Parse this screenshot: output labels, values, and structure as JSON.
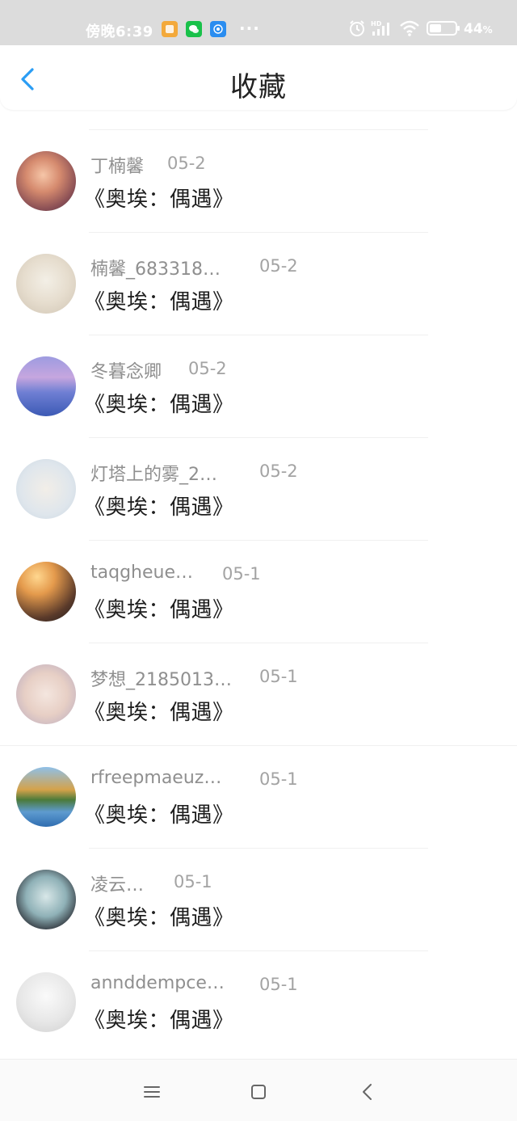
{
  "status_bar": {
    "time": "傍晚6:39",
    "dots": "···",
    "battery_percent": "44",
    "battery_unit": "%",
    "icons": [
      "alarm-icon",
      "hd-signal-icon",
      "wifi-icon",
      "battery-icon"
    ]
  },
  "header": {
    "title": "收藏",
    "back_icon": "chevron-left-icon",
    "accent_color": "#2a9df4"
  },
  "favorites": [
    {
      "username": "丁楠馨",
      "date": "05-2",
      "content": "《奥埃：偶遇》"
    },
    {
      "username": "楠馨_683318…",
      "date": "05-2",
      "content": "《奥埃：偶遇》"
    },
    {
      "username": "冬暮念卿",
      "date": "05-2",
      "content": "《奥埃：偶遇》"
    },
    {
      "username": "灯塔上的雾_2…",
      "date": "05-2",
      "content": "《奥埃：偶遇》"
    },
    {
      "username": "taqgheue…",
      "date": "05-1",
      "content": "《奥埃：偶遇》"
    },
    {
      "username": "梦想_2185013…",
      "date": "05-1",
      "content": "《奥埃：偶遇》"
    },
    {
      "username": "rfreepmaeuz…",
      "date": "05-1",
      "content": "《奥埃：偶遇》"
    },
    {
      "username": "凌云…",
      "date": "05-1",
      "content": "《奥埃：偶遇》"
    },
    {
      "username": "annddempce…",
      "date": "05-1",
      "content": "《奥埃：偶遇》"
    }
  ],
  "nav_bar": {
    "icons": [
      "menu-icon",
      "home-square-icon",
      "back-triangle-icon"
    ]
  }
}
